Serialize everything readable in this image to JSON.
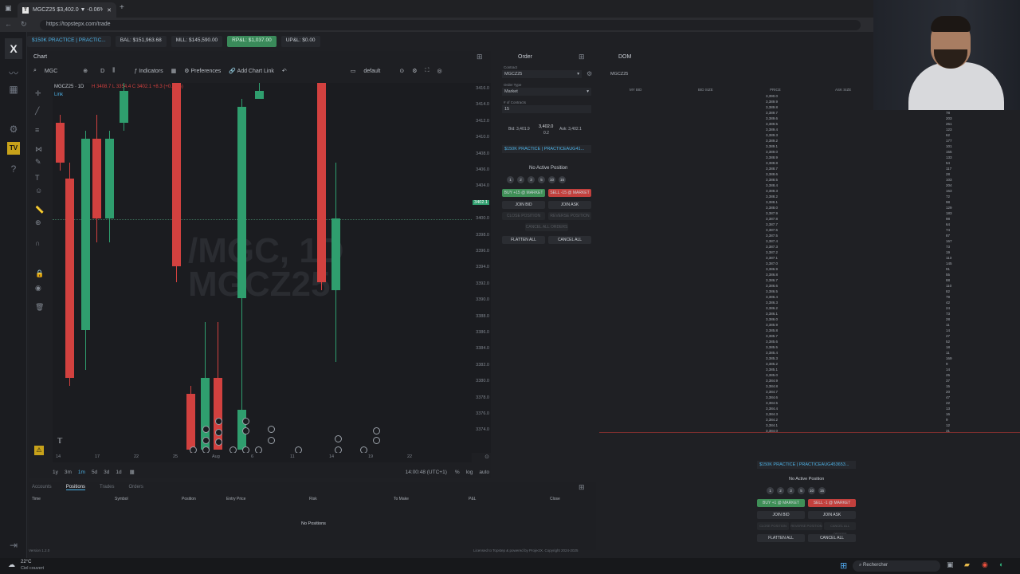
{
  "browser": {
    "tab_title": "MGCZ25 $3,402.0 ▼ -0.06%",
    "url": "https://topstepx.com/trade"
  },
  "account_bar": {
    "practice": "$150K PRACTICE | PRACTIC...",
    "bal": "BAL: $151,963.68",
    "mll": "MLL: $145,590.00",
    "rpnl": "RP&L: $1,037.00",
    "upnl": "UP&L: $0.00"
  },
  "chart": {
    "title": "Chart",
    "symbol": "MGC",
    "interval": "D",
    "indicators_label": "Indicators",
    "preferences_label": "Preferences",
    "add_chart_link_label": "Add Chart Link",
    "default_label": "default",
    "legend": "MGCZ25 · 1D",
    "ohlc": "H 3408.7  L 3354.4  C 3402.1  +8.3 (+0.24%)",
    "link_label": "Link",
    "watermark_line1": "/MGC, 1D",
    "watermark_line2": "MGCZ25",
    "price_ticks": [
      "3416.0",
      "3414.0",
      "3412.0",
      "3410.0",
      "3408.0",
      "3406.0",
      "3404.0",
      "3402.1",
      "3400.0",
      "3398.0",
      "3396.0",
      "3394.0",
      "3392.0",
      "3390.0",
      "3388.0",
      "3386.0",
      "3384.0",
      "3382.0",
      "3380.0",
      "3378.0",
      "3376.0",
      "3374.0"
    ],
    "time_ticks": [
      "14",
      "17",
      "22",
      "25",
      "Aug",
      "6",
      "11",
      "14",
      "19",
      "22"
    ],
    "timeframes": [
      "1y",
      "3m",
      "1m",
      "5d",
      "3d",
      "1d"
    ],
    "clock": "14:00:48 (UTC+1)",
    "percent": "%",
    "log": "log",
    "auto": "auto"
  },
  "order_panel": {
    "title": "Order",
    "contract_label": "Contract",
    "contract": "MGCZ25",
    "order_type_label": "Order Type",
    "order_type": "Market",
    "contracts_label": "# of Contracts",
    "contracts": "15",
    "bid": "Bid: 3,401.9",
    "last": "3,402.0",
    "spread": "0.2",
    "ask": "Ask: 3,402.1",
    "account": "$150K PRACTICE | PRACTICEAUG41...",
    "no_position": "No Active Position",
    "size_buttons": [
      "1",
      "2",
      "3",
      "5",
      "10",
      "15"
    ],
    "buy_btn": "BUY +15 @ MARKET",
    "sell_btn": "SELL -15 @ MARKET",
    "join_bid": "JOIN BID",
    "join_ask": "JOIN ASK",
    "close_position": "CLOSE POSITION",
    "reverse_position": "REVERSE POSITION",
    "cancel_all_orders": "CANCEL ALL ORDERS",
    "flatten_all": "FLATTEN ALL",
    "cancel_all": "CANCEL ALL"
  },
  "dom_panel": {
    "title": "DOM",
    "contract": "MGCZ25",
    "headers": [
      "MY BID",
      "BID SIZE",
      "PRICE",
      "ASK SIZE"
    ],
    "prices": [
      "3,390.0",
      "3,389.9",
      "3,389.8",
      "3,389.7",
      "3,389.6",
      "3,389.5",
      "3,389.4",
      "3,389.3",
      "3,389.2",
      "3,389.1",
      "3,389.0",
      "3,388.9",
      "3,388.8",
      "3,388.7",
      "3,388.6",
      "3,388.5",
      "3,388.4",
      "3,388.3",
      "3,388.2",
      "3,388.1",
      "3,388.0",
      "3,387.9",
      "3,387.8",
      "3,387.7",
      "3,387.6",
      "3,387.5",
      "3,387.4",
      "3,387.3",
      "3,387.2",
      "3,387.1",
      "3,387.0",
      "3,386.9",
      "3,386.8",
      "3,386.7",
      "3,386.6",
      "3,386.5",
      "3,386.4",
      "3,386.3",
      "3,386.2",
      "3,386.1",
      "3,386.0",
      "3,385.9",
      "3,385.8",
      "3,385.7",
      "3,385.6",
      "3,385.5",
      "3,385.4",
      "3,385.3",
      "3,385.2",
      "3,385.1",
      "3,385.0",
      "3,384.9",
      "3,384.8",
      "3,384.7",
      "3,384.6",
      "3,384.5",
      "3,384.4",
      "3,384.3",
      "3,384.2",
      "3,384.1",
      "3,384.0"
    ],
    "sizes": [
      "82",
      "60",
      "31",
      "78",
      "203",
      "261",
      "123",
      "62",
      "177",
      "101",
      "155",
      "133",
      "54",
      "117",
      "28",
      "103",
      "204",
      "163",
      "72",
      "98",
      "129",
      "183",
      "98",
      "64",
      "74",
      "87",
      "167",
      "73",
      "19",
      "113",
      "145",
      "91",
      "55",
      "88",
      "110",
      "82",
      "79",
      "42",
      "24",
      "73",
      "28",
      "11",
      "14",
      "27",
      "52",
      "18",
      "11",
      "169",
      "9",
      "14",
      "25",
      "37",
      "15",
      "20",
      "47",
      "22",
      "13",
      "16",
      "9",
      "12",
      "31"
    ],
    "account": "$150K PRACTICE | PRACTICEAUG453653...",
    "no_position": "No Active Position",
    "size_buttons": [
      "1",
      "2",
      "3",
      "5",
      "10",
      "15"
    ],
    "buy_btn": "BUY +1 @ MARKET",
    "sell_btn": "SELL -1 @ MARKET",
    "join_bid": "JOIN BID",
    "join_ask": "JOIN ASK",
    "close_position": "CLOSE POSITION",
    "reverse_position": "REVERSE POSITION",
    "cancel_all_orders": "CANCEL ALL ORDERS",
    "flatten_all": "FLATTEN ALL",
    "cancel_all": "CANCEL ALL"
  },
  "positions_panel": {
    "tabs": [
      "Accounts",
      "Positions",
      "Trades",
      "Orders"
    ],
    "columns": [
      "Time",
      "Symbol",
      "Position",
      "Entry Price",
      "Risk",
      "To Make",
      "P&L",
      "Close"
    ],
    "empty": "No Positions"
  },
  "footer": {
    "version": "Version 1.2.0",
    "licensed": "Licensed to Topstep & powered by ProjectX. Copyright 2024-2025"
  },
  "taskbar": {
    "weather_temp": "22°C",
    "weather_text": "Ciel couvert",
    "search_placeholder": "Rechercher"
  },
  "colors": {
    "up": "#2f9e6e",
    "down": "#d2413f",
    "background": "#1f2024"
  }
}
